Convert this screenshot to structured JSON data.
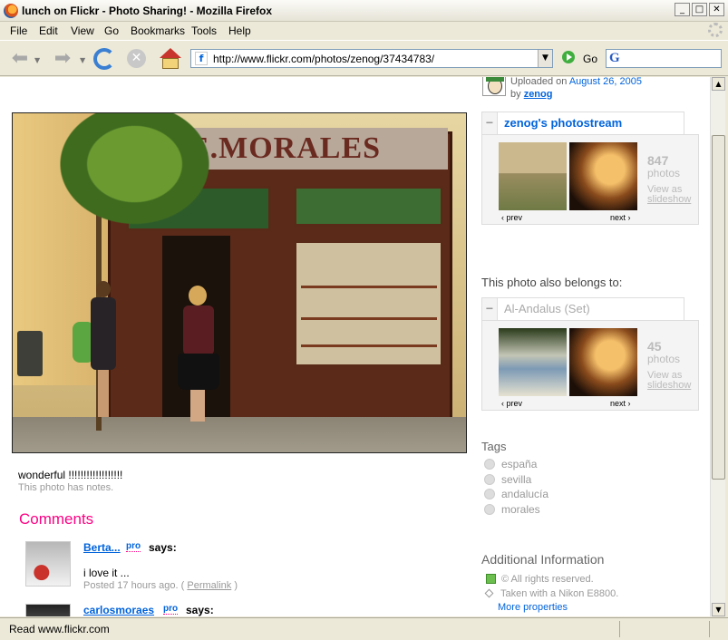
{
  "window": {
    "title": "lunch on Flickr - Photo Sharing! - Mozilla Firefox",
    "buttons": {
      "minimize": "_",
      "maximize": "□",
      "close": "✕"
    }
  },
  "menu": [
    "File",
    "Edit",
    "View",
    "Go",
    "Bookmarks",
    "Tools",
    "Help"
  ],
  "nav": {
    "url": "http://www.flickr.com/photos/zenog/37434783/",
    "go_label": "Go",
    "favicon": "f",
    "search_engine_glyph": "G"
  },
  "photo": {
    "sign_text": "E.MORALES",
    "description": "wonderful !!!!!!!!!!!!!!!!!!",
    "notes": "This photo has notes."
  },
  "comments": {
    "heading": "Comments",
    "items": [
      {
        "name": "Berta...",
        "pro": "pro",
        "says": "says:",
        "text": "i love it ...",
        "posted": "Posted 17 hours ago. (",
        "permalink": "Permalink",
        "close": ")"
      },
      {
        "name": "carlosmoraes",
        "pro": "pro",
        "says": "says:",
        "text": "",
        "posted": "",
        "permalink": "",
        "close": ""
      }
    ]
  },
  "uploader": {
    "uploaded_prefix": "Uploaded on",
    "uploaded_date": "August 26, 2005",
    "by_prefix": "by",
    "username": "zenog"
  },
  "photostream": {
    "title": "zenog's photostream",
    "count": "847",
    "unit": "photos",
    "view_as": "View as",
    "slideshow": "slideshow",
    "prev": "‹ prev",
    "next": "next ›"
  },
  "belongs": "This photo also belongs to:",
  "set": {
    "title": "Al-Andalus (Set)",
    "count": "45",
    "unit": "photos",
    "view_as": "View as",
    "slideshow": "slideshow",
    "prev": "‹ prev",
    "next": "next ›"
  },
  "tags": {
    "heading": "Tags",
    "items": [
      "españa",
      "sevilla",
      "andalucía",
      "morales"
    ]
  },
  "additional": {
    "heading": "Additional Information",
    "rights": "© All rights reserved.",
    "camera": "Taken with a Nikon E8800.",
    "more": "More properties"
  },
  "status": "Read www.flickr.com",
  "colors": {
    "flickr_blue": "#0063dc",
    "flickr_pink": "#ff0084"
  }
}
